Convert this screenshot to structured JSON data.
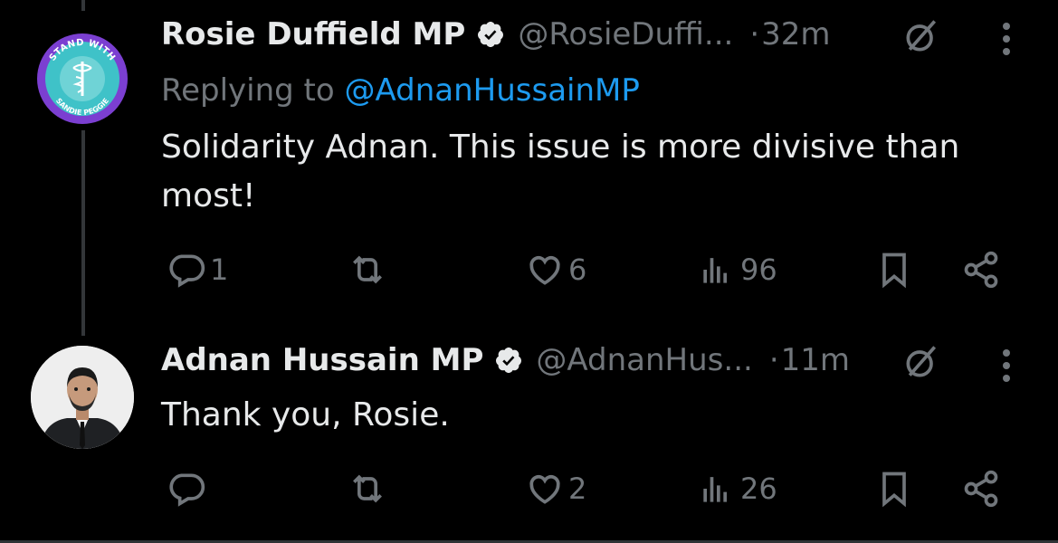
{
  "tweets": [
    {
      "author": "Rosie Duffield MP",
      "handle": "@RosieDuffi...",
      "separator": "·",
      "time": "32m",
      "replying_prefix": "Replying to ",
      "replying_to": "@AdnanHussainMP",
      "text": "Solidarity Adnan. This issue is more divisive than most!",
      "avatar_badge": {
        "top": "STAND WITH",
        "bottom": "SANDIE PEGGIE"
      },
      "stats": {
        "replies": "1",
        "retweets": "",
        "likes": "6",
        "views": "96"
      }
    },
    {
      "author": "Adnan Hussain MP",
      "handle": "@AdnanHus...",
      "separator": "·",
      "time": "11m",
      "text": "Thank you, Rosie.",
      "stats": {
        "replies": "",
        "retweets": "",
        "likes": "2",
        "views": "26"
      }
    }
  ],
  "colors": {
    "background": "#000000",
    "text": "#e7e9ea",
    "muted": "#71767b",
    "link": "#1d9bf0",
    "verified_badge": "#e7e9ea",
    "avatar_ring": "#7b3fd1",
    "avatar_inner": "#3fc2c8"
  },
  "icons": [
    "verified-badge-icon",
    "grok-icon",
    "more-vertical-icon",
    "reply-icon",
    "retweet-icon",
    "like-icon",
    "views-icon",
    "bookmark-icon",
    "share-icon"
  ]
}
